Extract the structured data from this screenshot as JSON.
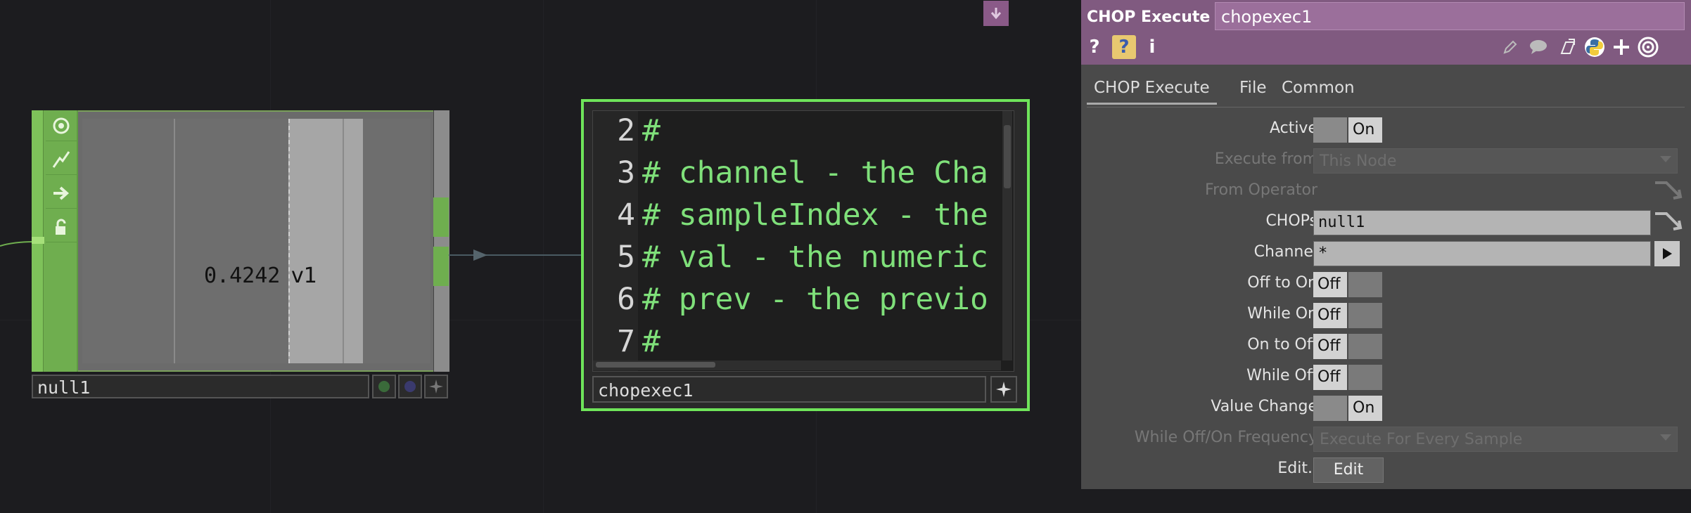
{
  "null_node": {
    "value": "0.4242",
    "channel": "v1",
    "name": "null1",
    "flag_icons": [
      "viewer-icon",
      "bypass-icon",
      "export-icon",
      "lock-icon"
    ]
  },
  "dat_node": {
    "name": "chopexec1",
    "lines": [
      {
        "no": "2",
        "code": "#"
      },
      {
        "no": "3",
        "code": "# channel - the Cha"
      },
      {
        "no": "4",
        "code": "# sampleIndex - the"
      },
      {
        "no": "5",
        "code": "# val - the numeric"
      },
      {
        "no": "6",
        "code": "# prev - the previo"
      },
      {
        "no": "7",
        "code": "#"
      }
    ]
  },
  "panel": {
    "op_type": "CHOP Execute",
    "op_name": "chopexec1",
    "tabs": [
      "CHOP Execute",
      "File",
      "Common"
    ],
    "params": {
      "active": {
        "label": "Active",
        "value": "On"
      },
      "execute_from": {
        "label": "Execute from",
        "value": "This Node"
      },
      "from_operator": {
        "label": "From Operator"
      },
      "chops": {
        "label": "CHOPs",
        "value": "null1"
      },
      "channel": {
        "label": "Channel",
        "value": "*"
      },
      "off_to_on": {
        "label": "Off to On",
        "value": "Off"
      },
      "while_on": {
        "label": "While On",
        "value": "Off"
      },
      "on_to_off": {
        "label": "On to Off",
        "value": "Off"
      },
      "while_off": {
        "label": "While Off",
        "value": "Off"
      },
      "value_change": {
        "label": "Value Change",
        "value": "On"
      },
      "frequency": {
        "label": "While Off/On Frequency",
        "value": "Execute For Every Sample"
      },
      "edit": {
        "label": "Edit..",
        "button": "Edit"
      }
    }
  },
  "colors": {
    "accent_green": "#6fe45a",
    "header_purple": "#805a80",
    "code_green": "#7fe07a"
  }
}
